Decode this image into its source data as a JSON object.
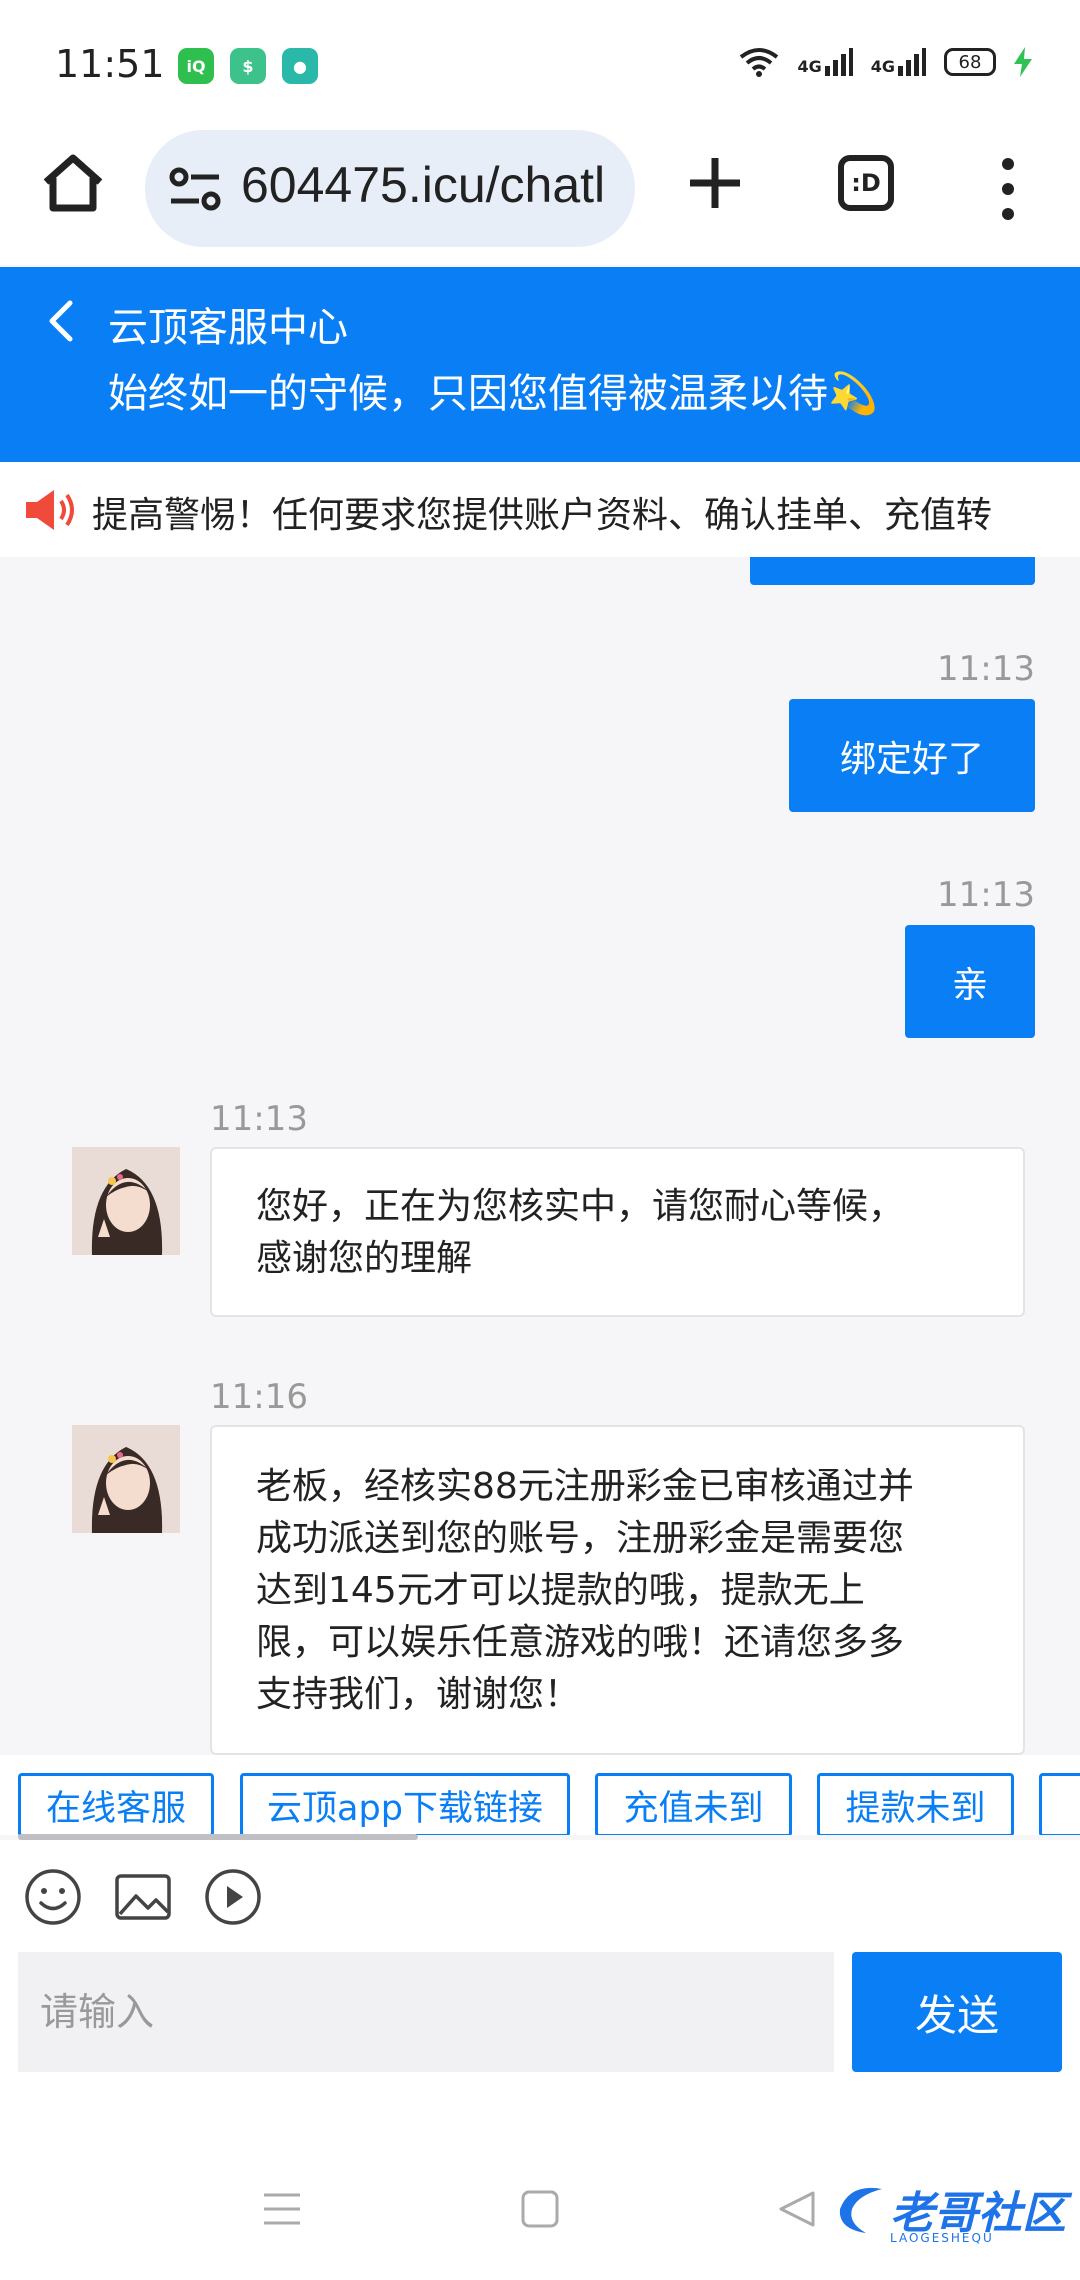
{
  "status_bar": {
    "time": "11:51",
    "battery": "68",
    "signal1": "4G",
    "signal2": "4G",
    "app_icons": [
      "iqiyi-icon",
      "wallet-icon",
      "message-icon"
    ]
  },
  "browser": {
    "url": "604475.icu/chatl",
    "tabs_label": ":D"
  },
  "header": {
    "title": "云顶客服中心",
    "subtitle": "始终如一的守候，只因您值得被温柔以待💫"
  },
  "notice": {
    "text": "提高警惕！任何要求您提供账户资料、确认挂单、充值转"
  },
  "messages": [
    {
      "direction": "out",
      "time": "11:13",
      "text": "绑定好了"
    },
    {
      "direction": "out",
      "time": "11:13",
      "text": "亲"
    },
    {
      "direction": "in",
      "time": "11:13",
      "text": "您好，正在为您核实中，请您耐心等候，感谢您的理解",
      "lines": [
        "您好，正在为您核实中，请您耐心等候，",
        "感谢您的理解"
      ]
    },
    {
      "direction": "in",
      "time": "11:16",
      "text": "老板，经核实88元注册彩金已审核通过并成功派送到您的账号，注册彩金是需要您达到145元才可以提款的哦，提款无上限，可以娱乐任意游戏的哦！还请您多多支持我们，谢谢您！",
      "lines": [
        "老板，经核实88元注册彩金已审核通过并",
        "成功派送到您的账号，注册彩金是需要您",
        "达到145元才可以提款的哦，提款无上",
        "限，可以娱乐任意游戏的哦！还请您多多",
        "支持我们，谢谢您！"
      ]
    }
  ],
  "quick_replies": [
    "在线客服",
    "云顶app下载链接",
    "充值未到",
    "提款未到"
  ],
  "input": {
    "placeholder": "请输入",
    "send_label": "发送"
  },
  "watermark": {
    "text": "老哥社区",
    "sub": "LAOGESHEQU"
  },
  "colors": {
    "accent": "#0a7ff5",
    "chat_bg": "#f6f6f8"
  }
}
